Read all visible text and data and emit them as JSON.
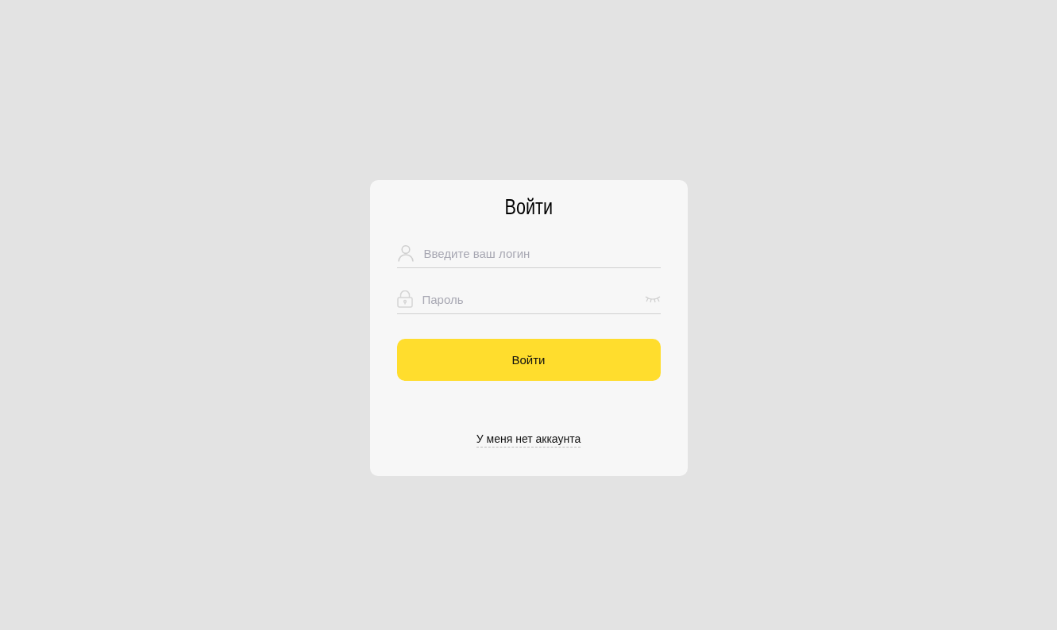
{
  "title": "Войти",
  "fields": [
    {
      "kind": "login",
      "placeholder": "Введите ваш логин"
    },
    {
      "kind": "password",
      "placeholder": "Пароль"
    }
  ],
  "submit": "Войти",
  "register_link": "У меня нет аккаунта"
}
